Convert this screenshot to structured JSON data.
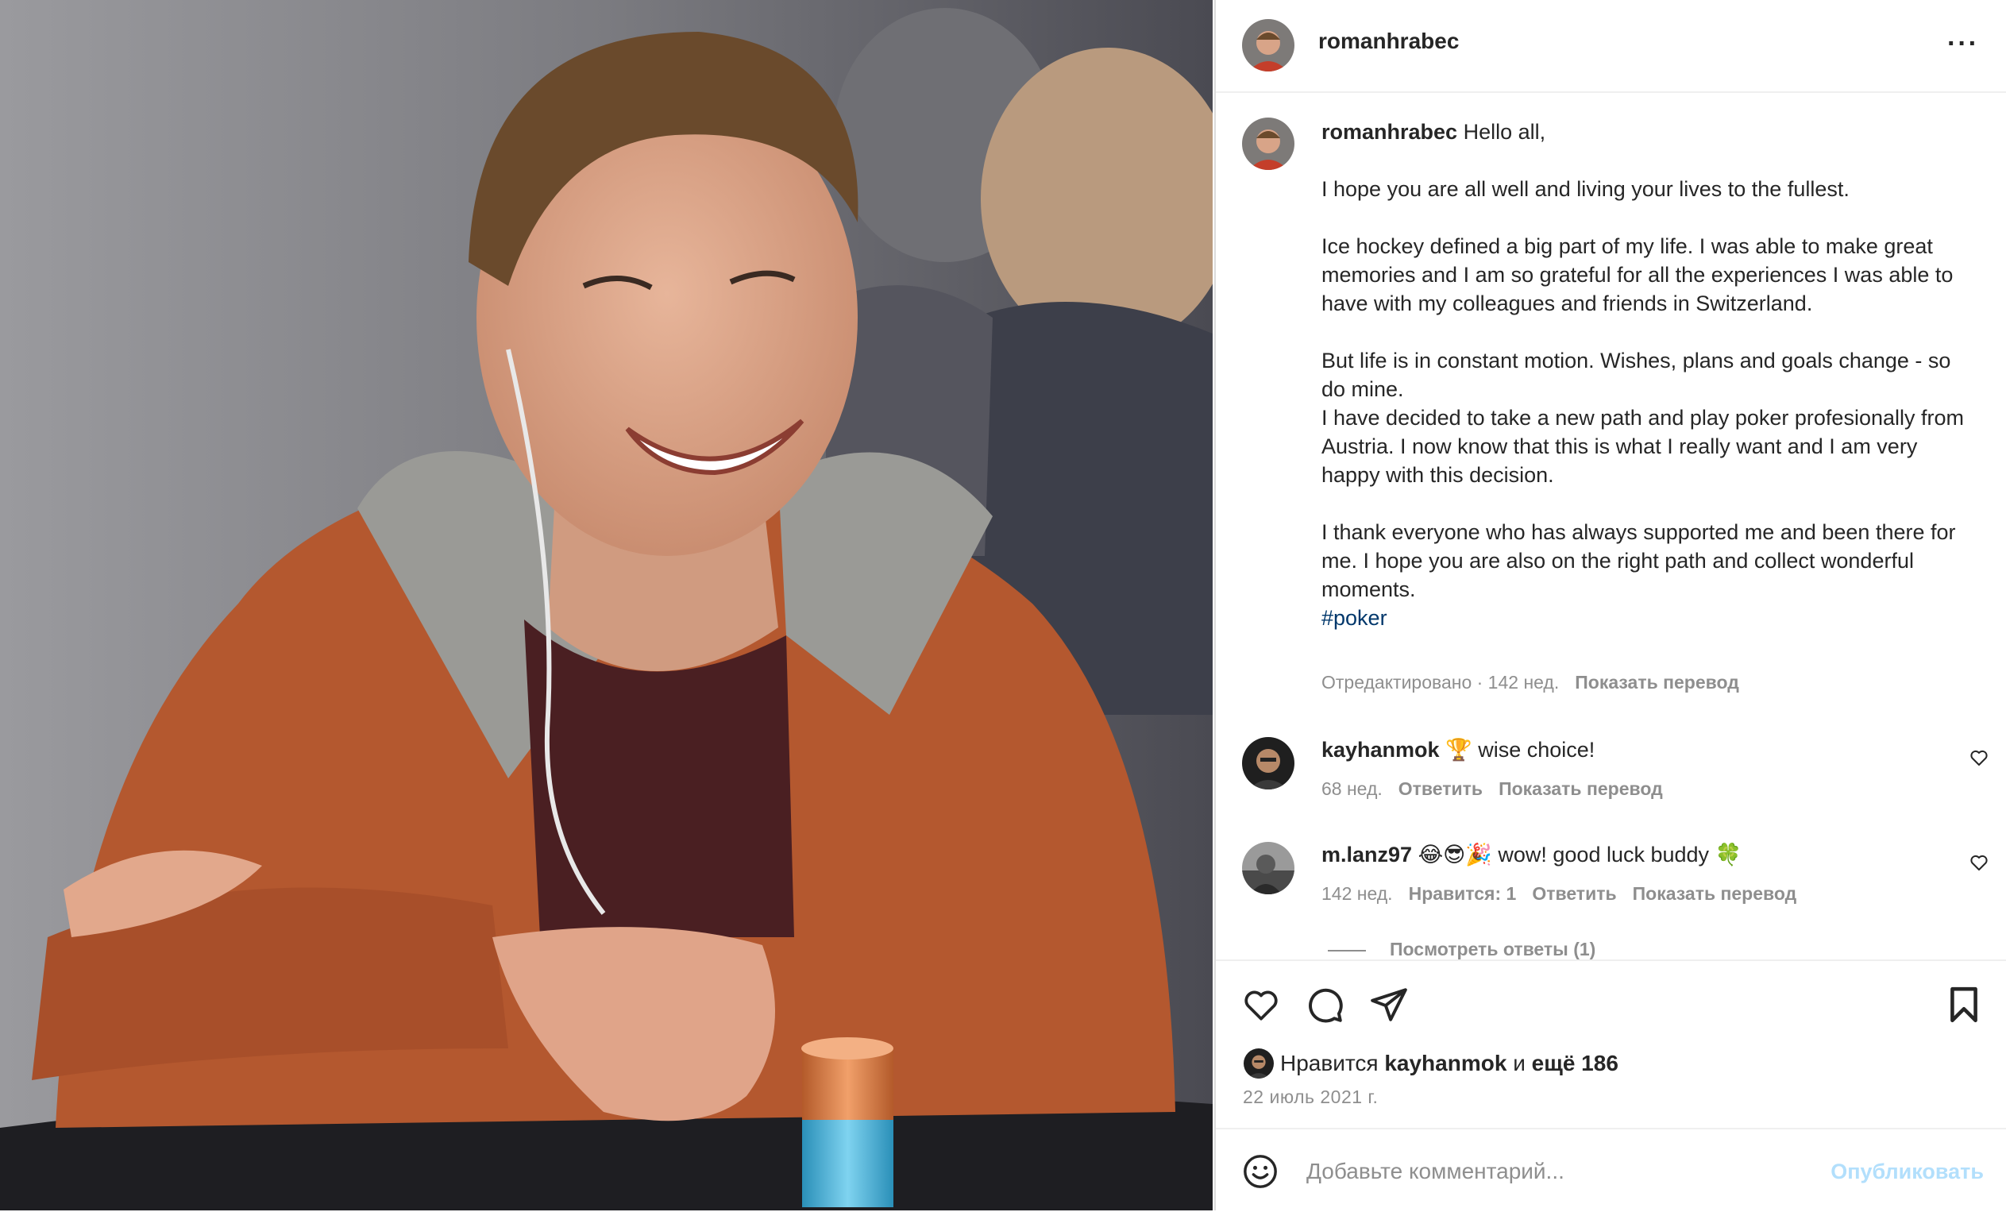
{
  "colors": {
    "link_blue": "#00376b",
    "muted": "#8e8e8e",
    "post_disabled": "#b2dffc",
    "hoodie": "#b4582f"
  },
  "post": {
    "author": "romanhrabec",
    "more_icon": "more-horizontal-icon",
    "caption": {
      "author": "romanhrabec",
      "greeting": " Hello all,",
      "body": "\n\nI hope you are all well and living your lives to the fullest.\n\nIce hockey defined a big part of my life. I was able to make great memories and I am so grateful for all the experiences I was able to have with my colleagues and friends in Switzerland.\n\nBut life is in constant motion. Wishes, plans and goals change - so do mine.\nI have decided to take a new path and play poker profesionally from Austria. I now know that this is what I really want and I am very happy with this decision.\n\nI thank everyone who has always supported me and been there for me. I hope you are also on the right path and collect wonderful moments.\n",
      "hashtag": "#poker",
      "edited": "Отредактировано · 142 нед.",
      "translate": "Показать перевод"
    },
    "comments": [
      {
        "user": "kayhanmok",
        "text": " 🏆 wise choice!",
        "age": "68 нед.",
        "reply": "Ответить",
        "translate": "Показать перевод"
      },
      {
        "user": "m.lanz97",
        "text": " 😂😎🎉 wow! good luck buddy 🍀",
        "age": "142 нед.",
        "likes": "Нравится: 1",
        "reply": "Ответить",
        "translate": "Показать перевод"
      }
    ],
    "view_replies": "Посмотреть ответы (1)",
    "actions": {
      "like_icon": "heart-icon",
      "comment_icon": "comment-icon",
      "share_icon": "send-icon",
      "save_icon": "bookmark-icon"
    },
    "likes": {
      "prefix": "Нравится ",
      "user": "kayhanmok",
      "and": " и ",
      "others": "ещё 186"
    },
    "date": "22 июль 2021 г.",
    "composer": {
      "emoji_icon": "emoji-icon",
      "placeholder": "Добавьте комментарий...",
      "post_label": "Опубликовать"
    }
  }
}
